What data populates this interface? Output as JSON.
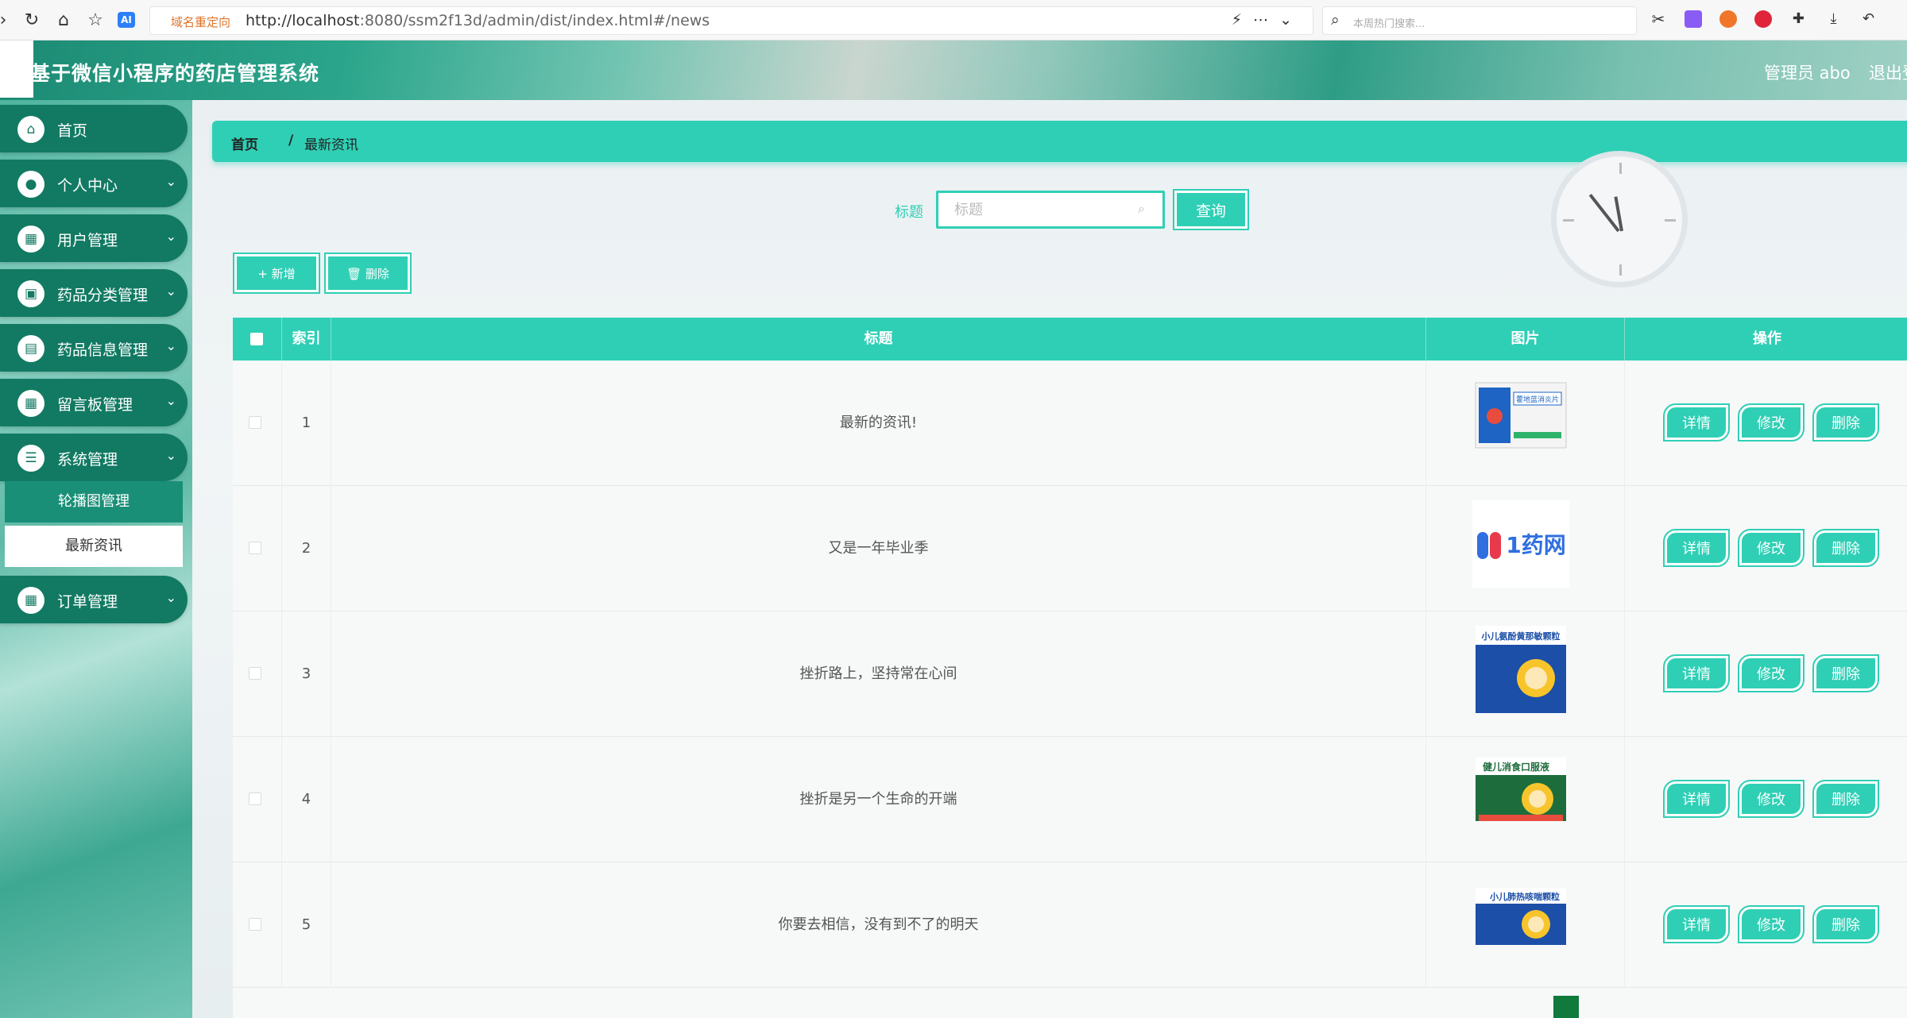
{
  "browser": {
    "redirect_tag": "域名重定向",
    "url_host": "http://localhost",
    "url_path": ":8080/ssm2f13d/admin/dist/index.html#/news",
    "search_hint": "本周热门搜索..."
  },
  "header": {
    "title": "基于微信小程序的药店管理系统",
    "admin": "管理员 abo",
    "logout": "退出登"
  },
  "sidebar": {
    "items": [
      {
        "label": "首页",
        "icon": "home-icon",
        "glyph": "⌂",
        "has_arrow": false
      },
      {
        "label": "个人中心",
        "icon": "user-icon",
        "glyph": "●",
        "has_arrow": true
      },
      {
        "label": "用户管理",
        "icon": "grid-icon",
        "glyph": "▦",
        "has_arrow": true
      },
      {
        "label": "药品分类管理",
        "icon": "wallet-icon",
        "glyph": "▣",
        "has_arrow": true
      },
      {
        "label": "药品信息管理",
        "icon": "clipboard-icon",
        "glyph": "▤",
        "has_arrow": true
      },
      {
        "label": "留言板管理",
        "icon": "grid-icon",
        "glyph": "▦",
        "has_arrow": true
      },
      {
        "label": "系统管理",
        "icon": "sliders-icon",
        "glyph": "☰",
        "has_arrow": true
      },
      {
        "label": "订单管理",
        "icon": "grid-icon",
        "glyph": "▦",
        "has_arrow": true
      }
    ],
    "submenu": [
      {
        "label": "轮播图管理"
      },
      {
        "label": "最新资讯"
      }
    ]
  },
  "breadcrumb": {
    "home": "首页",
    "separator": "/",
    "current": "最新资讯"
  },
  "search": {
    "label": "标题",
    "placeholder": "标题",
    "button": "查询"
  },
  "toolbar": {
    "add": "+ 新增",
    "delete": "🗑 删除"
  },
  "table": {
    "headers": [
      "索引",
      "标题",
      "图片",
      "操作"
    ],
    "rows": [
      {
        "index": "1",
        "title": "最新的资讯!",
        "image": "medicine-box-blue"
      },
      {
        "index": "2",
        "title": "又是一年毕业季",
        "image": "1yao-logo"
      },
      {
        "index": "3",
        "title": "挫折路上，坚持常在心间",
        "image": "medicine-box-cartoon"
      },
      {
        "index": "4",
        "title": "挫折是另一个生命的开端",
        "image": "medicine-box-green"
      },
      {
        "index": "5",
        "title": "你要去相信，没有到不了的明天",
        "image": "medicine-box-cartoon-2"
      }
    ],
    "row_actions": {
      "detail": "详情",
      "edit": "修改",
      "delete": "删除"
    }
  },
  "thumb_texts": {
    "box1": "藿地蓝消炎片",
    "box2_logo": "1药网",
    "box3": "小儿氨酚黄那敏颗粒",
    "box4": "健儿消食口服液",
    "box5": "小儿肺热咳喘颗粒"
  },
  "colors": {
    "accent": "#2fcfb5",
    "menu": "#127a63"
  }
}
